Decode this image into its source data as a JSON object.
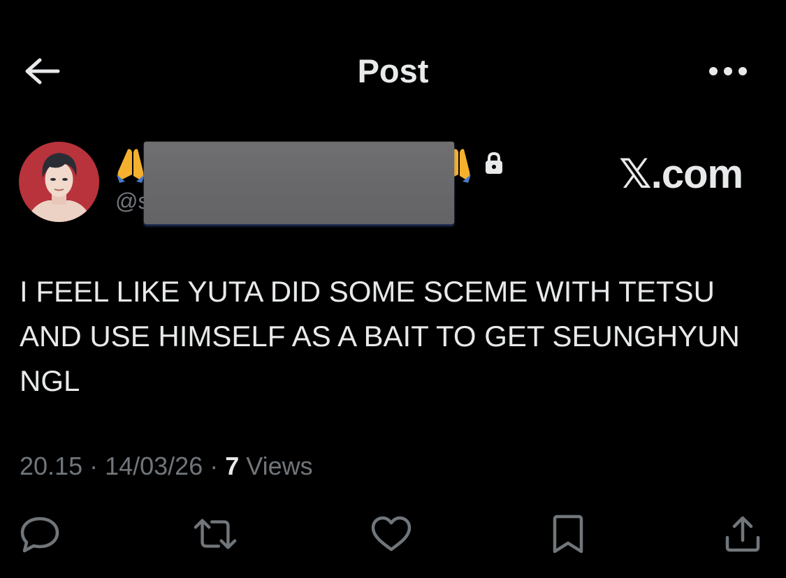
{
  "header": {
    "title": "Post",
    "back_icon": "arrow-left-icon",
    "more_icon": "more-horizontal-icon"
  },
  "author": {
    "display_name_prefix_emoji": "🙏",
    "display_name_suffix_emoji": "🙏",
    "handle_visible": "@s",
    "locked_icon": "lock-icon",
    "avatar_colors": {
      "background": "#b8333c",
      "hair": "#2b2d35",
      "skin": "#f1d9cc"
    }
  },
  "source_badge": "𝕏.com",
  "post": {
    "text": "I FEEL LIKE YUTA DID SOME SCEME WITH TETSU\nAND USE HIMSELF AS A BAIT TO GET SEUNGHYUN\nNGL"
  },
  "meta": {
    "time": "20.15",
    "separator": " · ",
    "date": "14/03/26",
    "views_count": "7",
    "views_label": " Views"
  },
  "actions": {
    "reply_icon": "reply-icon",
    "repost_icon": "repost-icon",
    "like_icon": "heart-icon",
    "bookmark_icon": "bookmark-icon",
    "share_icon": "share-icon"
  },
  "colors": {
    "background": "#000000",
    "text_primary": "#e7e9ea",
    "text_secondary": "#71767b",
    "icon": "#71767b",
    "redaction": "#6a6a6c"
  }
}
